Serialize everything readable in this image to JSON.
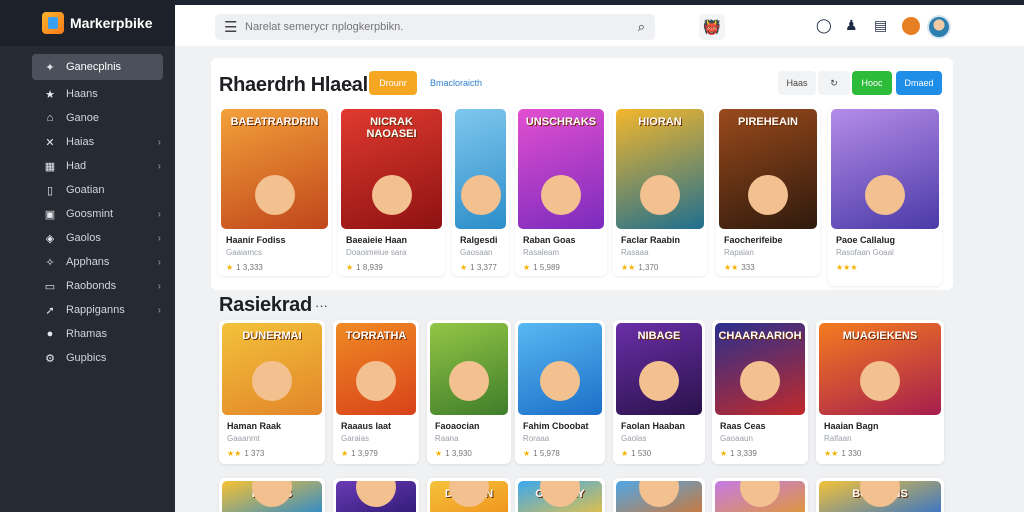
{
  "brand": {
    "name": "Markerpbike",
    "icon": "cube-logo-icon"
  },
  "sidebar": {
    "items": [
      {
        "label": "Ganecplnis",
        "icon": "megaphone-icon",
        "active": true,
        "chevron": false
      },
      {
        "label": "Haans",
        "icon": "star-icon",
        "active": false,
        "chevron": false
      },
      {
        "label": "Ganoe",
        "icon": "gamepad-icon",
        "active": false,
        "chevron": false
      },
      {
        "label": "Haias",
        "icon": "swords-icon",
        "active": false,
        "chevron": true
      },
      {
        "label": "Had",
        "icon": "grid-icon",
        "active": false,
        "chevron": true
      },
      {
        "label": "Goatian",
        "icon": "bookmark-icon",
        "active": false,
        "chevron": false
      },
      {
        "label": "Goosmint",
        "icon": "puzzle-icon",
        "active": false,
        "chevron": true
      },
      {
        "label": "Gaolos",
        "icon": "gift-icon",
        "active": false,
        "chevron": true
      },
      {
        "label": "Apphans",
        "icon": "apps-icon",
        "active": false,
        "chevron": true
      },
      {
        "label": "Raobonds",
        "icon": "document-icon",
        "active": false,
        "chevron": true
      },
      {
        "label": "Rappiganns",
        "icon": "rocket-icon",
        "active": false,
        "chevron": true
      },
      {
        "label": "Rhamas",
        "icon": "globe-icon",
        "active": false,
        "chevron": false
      },
      {
        "label": "Gupbics",
        "icon": "settings-icon",
        "active": false,
        "chevron": false
      }
    ]
  },
  "search": {
    "placeholder": "Narelat semerycr nplogkerpbikn."
  },
  "section1": {
    "title": "Rhaerdrh Hlaeal",
    "filter_active": "Drounr",
    "filter_link": "Bmacloraicth",
    "btn_new": "Haas",
    "btn_green": "Hooc",
    "btn_blue": "Dmaed",
    "games": [
      {
        "thumb_title": "BAEATRARDRIN",
        "name": "Haanir Fodiss",
        "sub": "Gaaiamcs",
        "rating": "1 3,333",
        "stars": "★",
        "colors": [
          "#f3a13a",
          "#c0461b"
        ]
      },
      {
        "thumb_title": "NICRAK NAOASEI",
        "name": "Baeaieie Haan",
        "sub": "Doaoimeiue sara",
        "rating": "1 8,939",
        "stars": "★",
        "colors": [
          "#e03a2f",
          "#8e1212"
        ]
      },
      {
        "thumb_title": "",
        "name": "Ralgesdi",
        "sub": "Gaosaan",
        "rating": "1 3,377",
        "stars": "★",
        "colors": [
          "#7fc7ee",
          "#2c8ec9"
        ]
      },
      {
        "thumb_title": "UNSCHRAKS",
        "name": "Raban Goas",
        "sub": "Rasaleam",
        "rating": "1 5,989",
        "stars": "★",
        "colors": [
          "#e24fd0",
          "#7b2bbd"
        ]
      },
      {
        "thumb_title": "HIORAN",
        "name": "Faclar Raabin",
        "sub": "Rasaaa",
        "rating": "1,370",
        "stars": "★★",
        "colors": [
          "#f4b72c",
          "#1f6f8f"
        ]
      },
      {
        "thumb_title": "PIREHEAIN",
        "name": "Faocherifeibe",
        "sub": "Rapaian",
        "rating": "333",
        "stars": "★★",
        "colors": [
          "#9a4a1c",
          "#2f1a0d"
        ]
      },
      {
        "thumb_title": "",
        "name": "Paoe Callalug",
        "sub": "Rasofaan Goaal",
        "rating": "",
        "stars": "★★★",
        "colors": [
          "#b58ce8",
          "#4a3aa8"
        ]
      }
    ]
  },
  "section2": {
    "title": "Rasiekrad",
    "games": [
      {
        "thumb_title": "DUNERMAI",
        "name": "Haman Raak",
        "sub": "Gaaanmt",
        "rating": "1 373",
        "stars": "★★",
        "colors": [
          "#f3c23a",
          "#e2852a"
        ]
      },
      {
        "thumb_title": "TORRATHA",
        "name": "Raaaus Iaat",
        "sub": "Garaias",
        "rating": "1 3,979",
        "stars": "★",
        "colors": [
          "#f08a24",
          "#d8421a"
        ]
      },
      {
        "thumb_title": "",
        "name": "Faoaocian",
        "sub": "Raana",
        "rating": "1 3,930",
        "stars": "★",
        "colors": [
          "#93c646",
          "#3f7d2a"
        ]
      },
      {
        "thumb_title": "",
        "name": "Fahim Cboobat",
        "sub": "Roraaa",
        "rating": "1 5,978",
        "stars": "★",
        "colors": [
          "#58b8f2",
          "#1c6fc8"
        ]
      },
      {
        "thumb_title": "NIBAGE",
        "name": "Faolan Haaban",
        "sub": "Gaolas",
        "rating": "1 530",
        "stars": "★",
        "colors": [
          "#6a2fa8",
          "#2a124a"
        ]
      },
      {
        "thumb_title": "CHAARAARIOH",
        "name": "Raas Ceas",
        "sub": "Gaoaaun",
        "rating": "1 3,339",
        "stars": "★",
        "colors": [
          "#2a2f8e",
          "#c02a2a"
        ]
      },
      {
        "thumb_title": "MUAGIEKENS",
        "name": "Haaian Bagn",
        "sub": "Ralfaan",
        "rating": "1 330",
        "stars": "★★",
        "colors": [
          "#f57b1f",
          "#a61e4e"
        ]
      }
    ]
  },
  "section3": {
    "games": [
      {
        "thumb_title": "ROGAS",
        "colors": [
          "#f8c232",
          "#1e86d8"
        ]
      },
      {
        "thumb_title": "",
        "colors": [
          "#6a3bb5",
          "#2a1870"
        ]
      },
      {
        "thumb_title": "DOODEN",
        "colors": [
          "#f5c33a",
          "#f08f1c"
        ]
      },
      {
        "thumb_title": "CARINEY",
        "colors": [
          "#3ba8ef",
          "#f3c23a"
        ]
      },
      {
        "thumb_title": "",
        "colors": [
          "#4fa7e8",
          "#d6742a"
        ]
      },
      {
        "thumb_title": "",
        "colors": [
          "#c57ae6",
          "#e19a2a"
        ]
      },
      {
        "thumb_title": "BORDANS",
        "colors": [
          "#f3c23a",
          "#2a6fd1"
        ]
      }
    ]
  },
  "topbar": {
    "icons": [
      "chat-icon",
      "user-icon",
      "calendar-icon",
      "gift-badge-icon"
    ]
  }
}
